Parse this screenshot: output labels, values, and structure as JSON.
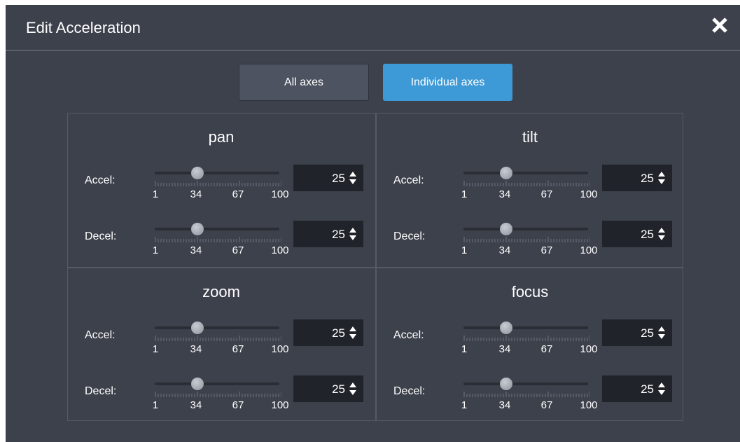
{
  "dialog": {
    "title": "Edit Acceleration",
    "close_icon": "close-icon"
  },
  "mode_toggle": {
    "options": [
      {
        "label": "All axes",
        "selected": false
      },
      {
        "label": "Individual axes",
        "selected": true
      }
    ]
  },
  "axes": [
    {
      "name": "pan",
      "accel": {
        "label": "Accel:",
        "value": "25",
        "min": 1,
        "max": 100,
        "ticks": [
          "1",
          "34",
          "67",
          "100"
        ]
      },
      "decel": {
        "label": "Decel:",
        "value": "25",
        "min": 1,
        "max": 100,
        "ticks": [
          "1",
          "34",
          "67",
          "100"
        ]
      }
    },
    {
      "name": "tilt",
      "accel": {
        "label": "Accel:",
        "value": "25",
        "min": 1,
        "max": 100,
        "ticks": [
          "1",
          "34",
          "67",
          "100"
        ]
      },
      "decel": {
        "label": "Decel:",
        "value": "25",
        "min": 1,
        "max": 100,
        "ticks": [
          "1",
          "34",
          "67",
          "100"
        ]
      }
    },
    {
      "name": "zoom",
      "accel": {
        "label": "Accel:",
        "value": "25",
        "min": 1,
        "max": 100,
        "ticks": [
          "1",
          "34",
          "67",
          "100"
        ]
      },
      "decel": {
        "label": "Decel:",
        "value": "25",
        "min": 1,
        "max": 100,
        "ticks": [
          "1",
          "34",
          "67",
          "100"
        ]
      }
    },
    {
      "name": "focus",
      "accel": {
        "label": "Accel:",
        "value": "25",
        "min": 1,
        "max": 100,
        "ticks": [
          "1",
          "34",
          "67",
          "100"
        ]
      },
      "decel": {
        "label": "Decel:",
        "value": "25",
        "min": 1,
        "max": 100,
        "ticks": [
          "1",
          "34",
          "67",
          "100"
        ]
      }
    }
  ],
  "colors": {
    "background": "#3d414c",
    "accent": "#3e9ad6",
    "spinner_bg": "#20242a"
  }
}
